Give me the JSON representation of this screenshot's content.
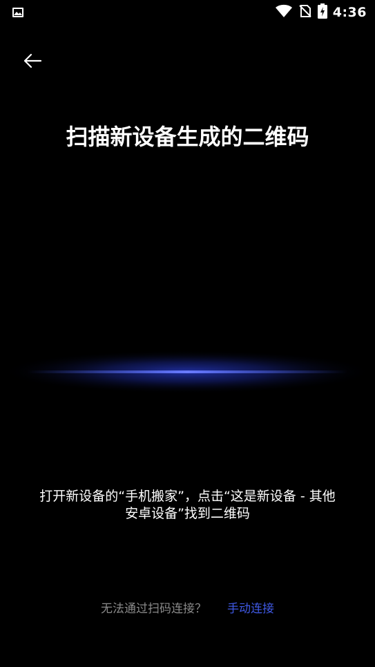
{
  "status_bar": {
    "time": "4:36",
    "icons": [
      "notification-image-icon",
      "wifi-icon",
      "no-sim-icon",
      "battery-charging-icon"
    ]
  },
  "header": {
    "back_icon": "arrow-left-icon",
    "title": "扫描新设备生成的二维码"
  },
  "scanner": {
    "glow_color": "#2a3fd6"
  },
  "instruction": {
    "line1": "打开新设备的“手机搬家”，点击“这是新设备 - 其他",
    "line2": "安卓设备”找到二维码"
  },
  "footer": {
    "question": "无法通过扫码连接？",
    "manual_link": "手动连接"
  },
  "colors": {
    "background": "#000000",
    "text": "#ffffff",
    "muted": "#8a8a8a",
    "accent": "#3f59e4"
  }
}
